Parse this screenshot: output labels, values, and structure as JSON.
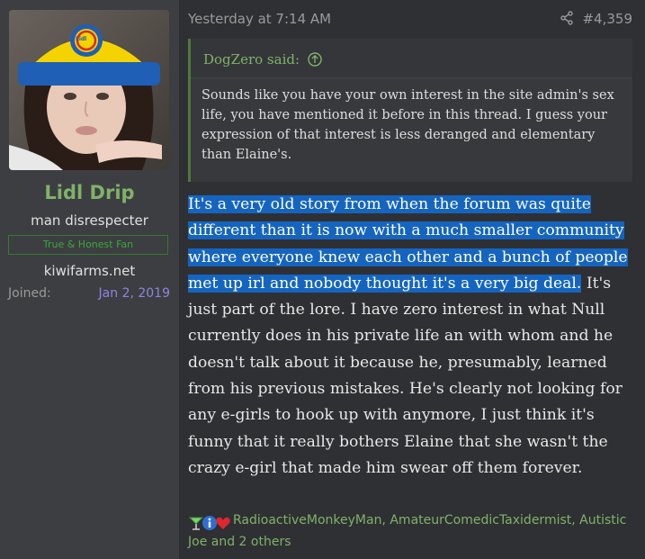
{
  "user": {
    "name": "Lidl Drip",
    "title": "man disrespecter",
    "banner": "True & Honest Fan",
    "site": "kiwifarms.net",
    "joined_label": "Joined:",
    "joined_date": "Jan 2, 2019",
    "avatar_logo": "Lidl"
  },
  "post": {
    "date": "Yesterday at 7:14 AM",
    "number": "#4,359",
    "share_icon": "share-icon",
    "quote": {
      "author": "DogZero said:",
      "text": "Sounds like you have your own interest in the site admin's sex life, you have mentioned it before in this thread. I guess your expression of that interest is less deranged and elementary than Elaine's."
    },
    "body_highlighted": "It's a very old story from when the forum was quite different than it is now with a much smaller community where everyone knew each other and a bunch of people met up irl and nobody thought it's a very big deal.",
    "body_rest": " It's just part of the lore. I have zero interest in what Null currently does in his private life an with whom and he doesn't talk about it because he, presumably, learned from his previous mistakes. He's clearly not looking for any e-girls to hook up with anymore, I just think it's funny that it really bothers Elaine that she wasn't the crazy e-girl that made him swear off them forever.",
    "reactions": {
      "icons": [
        "cocktail-icon",
        "info-icon",
        "heart-icon"
      ],
      "text": "RadioactiveMonkeyMan, AmateurComedicTaxidermist, Autistic Joe and 2 others"
    }
  },
  "colors": {
    "background": "#2f3033",
    "user_column": "#3d3e41",
    "username": "#7fb26a",
    "highlight": "#1565c0",
    "joined_date": "#8b86e0"
  }
}
